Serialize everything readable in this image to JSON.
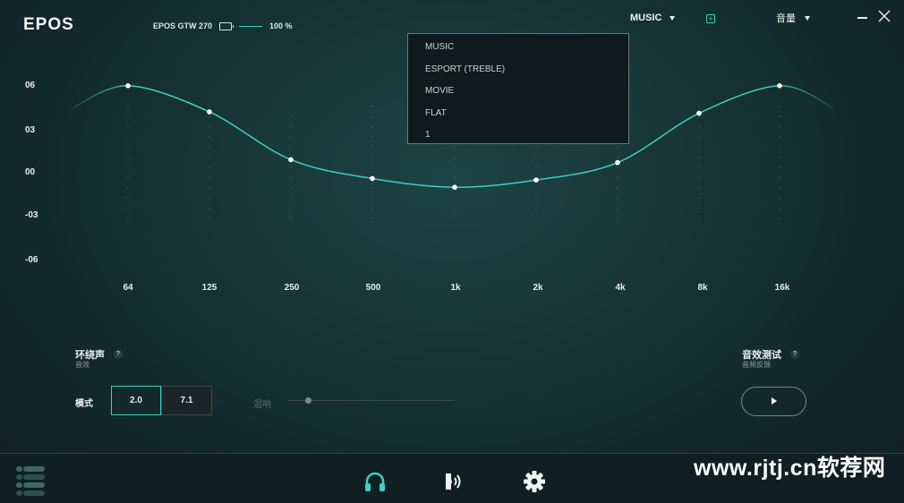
{
  "header": {
    "logo": "EPOS",
    "device_name": "EPOS GTW 270",
    "battery_level": "100 %",
    "preset_selected": "MUSIC",
    "language": "音量"
  },
  "preset_menu": {
    "items": [
      "MUSIC",
      "ESPORT (TREBLE)",
      "MOVIE",
      "FLAT",
      "1"
    ]
  },
  "equalizer": {
    "y_labels": [
      "06",
      "03",
      "00",
      "-03",
      "-06"
    ],
    "x_labels": [
      "64",
      "125",
      "250",
      "500",
      "1k",
      "2k",
      "4k",
      "8k",
      "16k"
    ],
    "gains_db": [
      6.0,
      4.2,
      0.9,
      -0.4,
      -1.0,
      -0.5,
      0.7,
      4.1,
      6.0
    ],
    "curve_color": "#3ecfc0"
  },
  "surround": {
    "title": "环绕声",
    "subtitle": "音效",
    "help": "?",
    "mode_label": "模式",
    "mode_options": [
      "2.0",
      "7.1"
    ],
    "mode_selected": "2.0",
    "reverb_label": "混响",
    "reverb_level": 0.12
  },
  "sound_test": {
    "title": "音效测试",
    "subtitle": "音频反馈",
    "help": "?"
  },
  "watermark": "www.rjtj.cn软荐网",
  "colors": {
    "accent": "#3ecfc0",
    "background": "#173536"
  }
}
